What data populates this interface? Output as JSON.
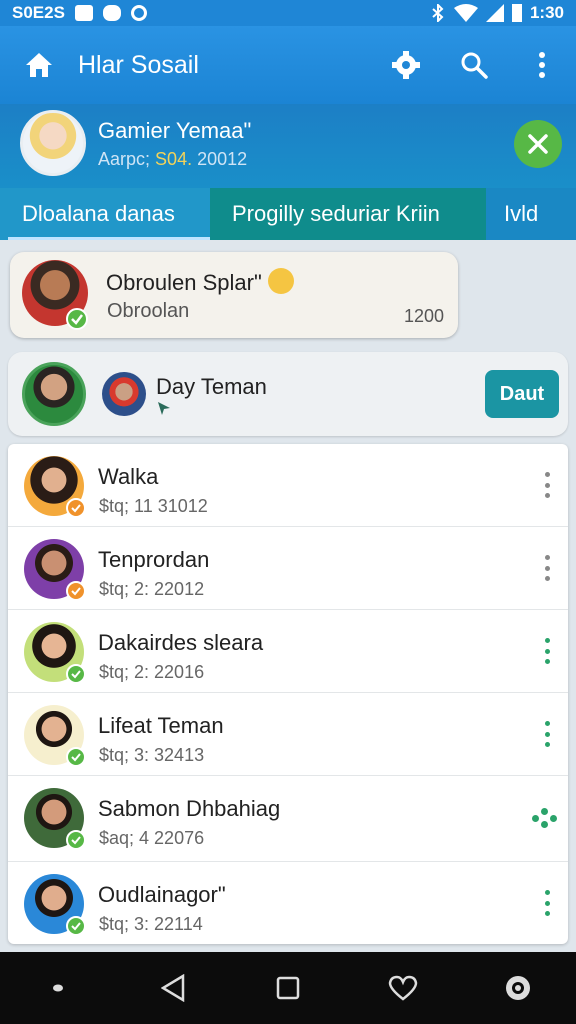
{
  "status_bar": {
    "left_text": "S0E2S",
    "time": "1:30",
    "icons": [
      "gallery-icon",
      "message-icon",
      "location-icon",
      "bluetooth-icon",
      "wifi-icon",
      "signal-icon",
      "battery-icon"
    ]
  },
  "app_bar": {
    "title": "Hlar Sosail",
    "icons": [
      "home-icon",
      "settings-icon",
      "search-icon",
      "more-vertical-icon"
    ]
  },
  "profile": {
    "name": "Gamier Yemaa\"",
    "date_prefix": "Aarpc;",
    "date_highlight": "S04.",
    "date_suffix": "20012",
    "close_icon": "close-icon"
  },
  "tabs": [
    {
      "label": "Dloalana danas",
      "selected": true
    },
    {
      "label": "Progilly seduriar Kriin"
    },
    {
      "label": "Ivld"
    }
  ],
  "chat_card": {
    "title": "Obroulen Splar\"",
    "subtitle": "Obroolan",
    "count": "1200"
  },
  "friend_card": {
    "label": "Day Teman",
    "button": "Daut"
  },
  "contacts": [
    {
      "name": "Walka",
      "meta": "$tq; 11 31012",
      "badge": "orange",
      "menu": "gray"
    },
    {
      "name": "Tenprordan",
      "meta": "$tq; 2: 22012",
      "badge": "orange",
      "menu": "gray"
    },
    {
      "name": "Dakairdes sleara",
      "meta": "$tq; 2: 22016",
      "badge": "green",
      "menu": "green"
    },
    {
      "name": "Lifeat Teman",
      "meta": "$tq; 3: 32413",
      "badge": "green",
      "menu": "green"
    },
    {
      "name": "Sabmon Dhbahiag",
      "meta": "$aq; 4 22076",
      "badge": "green",
      "menu": "green-grid"
    },
    {
      "name": "Oudlainagor\"",
      "meta": "$tq; 3: 22114",
      "badge": "green",
      "menu": "green"
    }
  ],
  "colors": {
    "app_bar": "#1f86d6",
    "tab_active": "#0f8c8c",
    "online_green": "#57b846",
    "action_teal": "#1b95a3",
    "badge_orange": "#f0922b"
  },
  "nav_bar": {
    "icons": [
      "dot-icon",
      "back-icon",
      "home-square-icon",
      "heart-icon",
      "camera-icon"
    ]
  }
}
